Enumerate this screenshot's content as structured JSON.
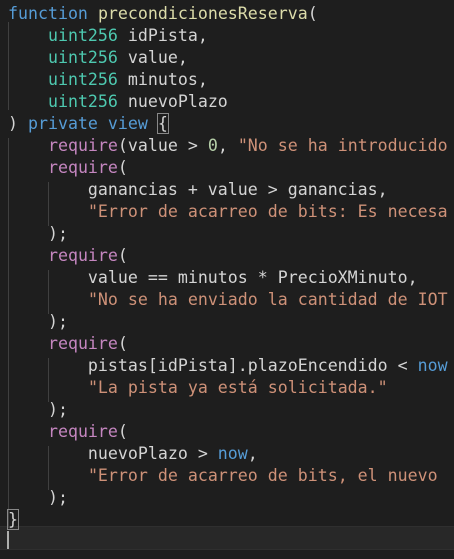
{
  "editor": {
    "language": "solidity",
    "colors": {
      "background": "#1e1e1e",
      "keyword": "#569cd6",
      "type": "#4ec9b0",
      "function": "#dcdcaa",
      "control": "#c586c0",
      "string": "#ce9178",
      "number": "#b5cea8",
      "default": "#d4d4d4"
    },
    "lines": [
      {
        "tokens": [
          [
            "kw",
            "function"
          ],
          [
            "pun",
            " "
          ],
          [
            "fn",
            "precondicionesReserva"
          ],
          [
            "pun",
            "("
          ]
        ]
      },
      {
        "tokens": [
          [
            "pun",
            "    "
          ],
          [
            "type",
            "uint256"
          ],
          [
            "id",
            " idPista,"
          ]
        ]
      },
      {
        "tokens": [
          [
            "pun",
            "    "
          ],
          [
            "type",
            "uint256"
          ],
          [
            "id",
            " value,"
          ]
        ]
      },
      {
        "tokens": [
          [
            "pun",
            "    "
          ],
          [
            "type",
            "uint256"
          ],
          [
            "id",
            " minutos,"
          ]
        ]
      },
      {
        "tokens": [
          [
            "pun",
            "    "
          ],
          [
            "type",
            "uint256"
          ],
          [
            "id",
            " nuevoPlazo"
          ]
        ]
      },
      {
        "tokens": [
          [
            "pun",
            ") "
          ],
          [
            "kw",
            "private"
          ],
          [
            "pun",
            " "
          ],
          [
            "kw",
            "view"
          ],
          [
            "pun",
            " "
          ],
          [
            "brk",
            "{"
          ]
        ]
      },
      {
        "tokens": [
          [
            "pun",
            "    "
          ],
          [
            "req",
            "require"
          ],
          [
            "pun",
            "(value > "
          ],
          [
            "num",
            "0"
          ],
          [
            "pun",
            ", "
          ],
          [
            "str",
            "\"No se ha introducido"
          ]
        ]
      },
      {
        "tokens": [
          [
            "pun",
            "    "
          ],
          [
            "req",
            "require"
          ],
          [
            "pun",
            "("
          ]
        ]
      },
      {
        "tokens": [
          [
            "pun",
            "        ganancias + value > ganancias,"
          ]
        ]
      },
      {
        "tokens": [
          [
            "pun",
            "        "
          ],
          [
            "str",
            "\"Error de acarreo de bits: Es necesa"
          ]
        ]
      },
      {
        "tokens": [
          [
            "pun",
            "    );"
          ]
        ]
      },
      {
        "tokens": [
          [
            "pun",
            "    "
          ],
          [
            "req",
            "require"
          ],
          [
            "pun",
            "("
          ]
        ]
      },
      {
        "tokens": [
          [
            "pun",
            "        value == minutos * PrecioXMinuto,"
          ]
        ]
      },
      {
        "tokens": [
          [
            "pun",
            "        "
          ],
          [
            "str",
            "\"No se ha enviado la cantidad de IOT"
          ]
        ]
      },
      {
        "tokens": [
          [
            "pun",
            "    );"
          ]
        ]
      },
      {
        "tokens": [
          [
            "pun",
            "    "
          ],
          [
            "req",
            "require"
          ],
          [
            "pun",
            "("
          ]
        ]
      },
      {
        "tokens": [
          [
            "pun",
            "        pistas[idPista].plazoEncendido < "
          ],
          [
            "kw",
            "now"
          ]
        ]
      },
      {
        "tokens": [
          [
            "pun",
            "        "
          ],
          [
            "str",
            "\"La pista ya está solicitada.\""
          ]
        ]
      },
      {
        "tokens": [
          [
            "pun",
            "    );"
          ]
        ]
      },
      {
        "tokens": [
          [
            "pun",
            "    "
          ],
          [
            "req",
            "require"
          ],
          [
            "pun",
            "("
          ]
        ]
      },
      {
        "tokens": [
          [
            "pun",
            "        nuevoPlazo > "
          ],
          [
            "kw",
            "now"
          ],
          [
            "pun",
            ","
          ]
        ]
      },
      {
        "tokens": [
          [
            "pun",
            "        "
          ],
          [
            "str",
            "\"Error de acarreo de bits, el nuevo "
          ]
        ]
      },
      {
        "tokens": [
          [
            "pun",
            "    );"
          ]
        ]
      },
      {
        "tokens": [
          [
            "brk",
            "}"
          ]
        ]
      }
    ]
  }
}
